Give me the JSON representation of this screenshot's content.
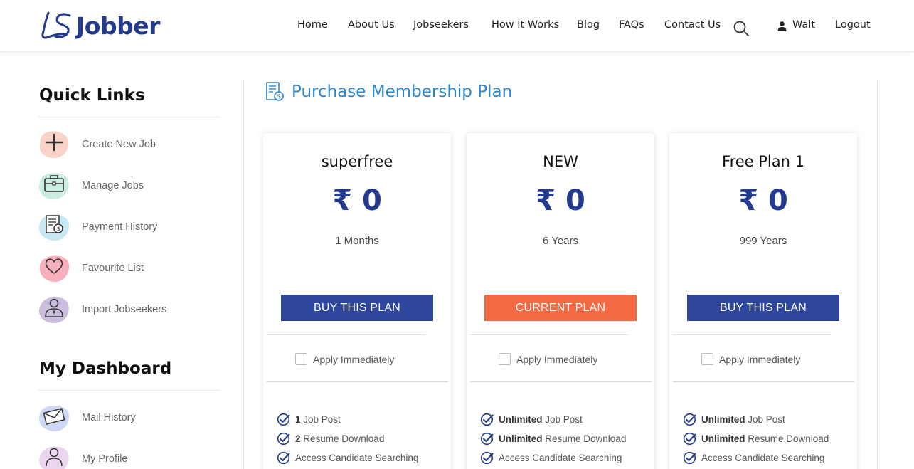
{
  "brand": {
    "name": "Jobber",
    "color": "#233a8f"
  },
  "nav": {
    "items": [
      "Home",
      "About Us",
      "Jobseekers",
      "How It Works",
      "Blog",
      "FAQs",
      "Contact Us"
    ],
    "user_name": "Walt",
    "logout": "Logout"
  },
  "sidebar": {
    "quick_links_title": "Quick Links",
    "quick_links": [
      {
        "label": "Create New Job",
        "icon": "plus-icon"
      },
      {
        "label": "Manage Jobs",
        "icon": "briefcase-icon"
      },
      {
        "label": "Payment History",
        "icon": "receipt-icon"
      },
      {
        "label": "Favourite List",
        "icon": "heart-icon"
      },
      {
        "label": "Import Jobseekers",
        "icon": "user-tie-icon"
      }
    ],
    "dashboard_title": "My Dashboard",
    "dashboard_links": [
      {
        "label": "Mail History",
        "icon": "mail-icon"
      },
      {
        "label": "My Profile",
        "icon": "profile-icon"
      }
    ]
  },
  "main": {
    "title": "Purchase Membership Plan",
    "apply_label": "Apply Immediately",
    "plans": [
      {
        "name": "superfree",
        "price": "₹ 0",
        "duration": "1 Months",
        "button": "BUY THIS PLAN",
        "current": false,
        "features": [
          {
            "strong": "1",
            "text": " Job Post"
          },
          {
            "strong": "2",
            "text": " Resume Download"
          },
          {
            "strong": "",
            "text": "Access Candidate Searching"
          }
        ]
      },
      {
        "name": "NEW",
        "price": "₹ 0",
        "duration": "6 Years",
        "button": "CURRENT PLAN",
        "current": true,
        "features": [
          {
            "strong": "Unlimited",
            "text": " Job Post"
          },
          {
            "strong": "Unlimited",
            "text": " Resume Download"
          },
          {
            "strong": "",
            "text": "Access Candidate Searching"
          }
        ]
      },
      {
        "name": "Free Plan 1",
        "price": "₹ 0",
        "duration": "999 Years",
        "button": "BUY THIS PLAN",
        "current": false,
        "features": [
          {
            "strong": "Unlimited",
            "text": " Job Post"
          },
          {
            "strong": "Unlimited",
            "text": " Resume Download"
          },
          {
            "strong": "",
            "text": "Access Candidate Searching"
          }
        ]
      }
    ]
  },
  "colors": {
    "primary": "#2e479c",
    "current": "#f26a44",
    "title_blue": "#2f86c8",
    "check_blue": "#233a8f"
  }
}
